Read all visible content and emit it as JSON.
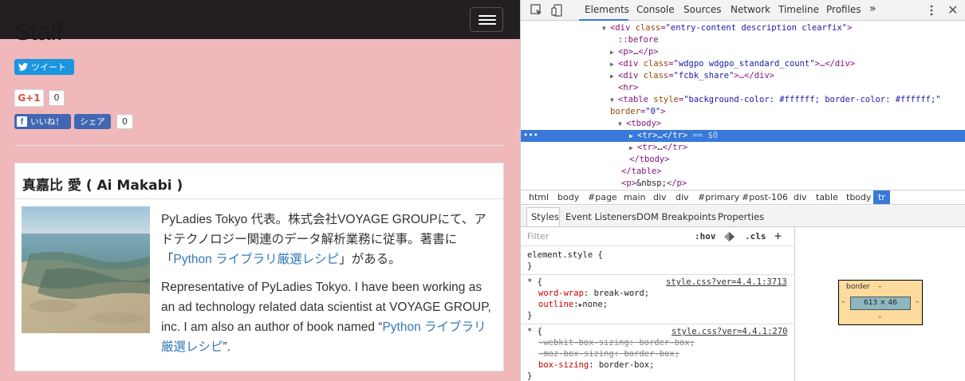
{
  "page": {
    "title": "Staff",
    "tweet_label": "ツイート",
    "gplus_label": "G+1",
    "gplus_count": "0",
    "fb_like_label": "いいね！",
    "fb_share_label": "シェア",
    "fb_count": "0",
    "person_name": "真嘉比 愛 ( Ai Makabi )",
    "bio_ja_pre": "PyLadies Tokyo 代表。株式会社VOYAGE GROUPにて、アドテクノロジー関連のデータ解析業務に従事。著書に「",
    "bio_ja_link": "Python ライブラリ厳選レシピ",
    "bio_ja_post": "」がある。",
    "bio_en_pre": "Representative of PyLadies Tokyo. I have been working as an ad technology related data scientist at VOYAGE GROUP, inc. I am also an author of book named “",
    "bio_en_link": "Python ライブラリ厳選レシピ",
    "bio_en_post": "”."
  },
  "devtools": {
    "tabs": [
      "Elements",
      "Console",
      "Sources",
      "Network",
      "Timeline",
      "Profiles"
    ],
    "more_tabs": "»",
    "dom": [
      {
        "tag_open": "<div ",
        "attr": "class",
        "val": "\"entry-content description clearfix\"",
        "close": ">"
      },
      {
        "text": "::before"
      },
      {
        "tag_open": "<p>",
        "text": "…",
        "close": "</p>"
      },
      {
        "tag_open": "<div ",
        "attr": "class",
        "val": "\"wdgpo wdgpo_standard_count\"",
        "close": ">…</div>"
      },
      {
        "tag_open": "<div ",
        "attr": "class",
        "val": "\"fcbk_share\"",
        "close": ">…</div>"
      },
      {
        "tag_open": "<hr>"
      },
      {
        "tag_open": "<table ",
        "attr": "style",
        "val": "\"background-color: #ffffff; border-color: #ffffff;\"",
        "close": ""
      },
      {
        "attr": "border",
        "val": "\"0\"",
        "close": ">"
      },
      {
        "tag_open": "<tbody>"
      },
      {
        "tag_open": "<tr>",
        "text": "…",
        "close": "</tr>",
        "marker": " == $0"
      },
      {
        "tag_open": "<tr>",
        "text": "…",
        "close": "</tr>"
      },
      {
        "tag_open": "</tbody>"
      },
      {
        "tag_open": "</table>"
      },
      {
        "tag_open": "<p>",
        "text": "&nbsp;",
        "close": "</p>"
      }
    ],
    "breadcrumbs": [
      "html",
      "body",
      "#page",
      "main",
      "div",
      "div",
      "#primary",
      "#post-106",
      "div",
      "table",
      "tbody",
      "tr"
    ],
    "sub_tabs": [
      "Styles",
      "Event Listeners",
      "DOM Breakpoints",
      "Properties"
    ],
    "filter_placeholder": "Filter",
    "hov_label": ":hov",
    "cls_label": ".cls",
    "plus_label": "+",
    "styles": {
      "element_style": "element.style {",
      "close_brace": "}",
      "rule1_selector": "* {",
      "rule1_source": "style.css?ver=4.4.1:3713",
      "rule1_prop1": "word-wrap",
      "rule1_val1": "break-word;",
      "rule1_prop2": "outline",
      "rule1_val2": "none;",
      "rule2_selector": "* {",
      "rule2_source": "style.css?ver=4.4.1:270",
      "rule2_prop1": "-webkit-box-sizing",
      "rule2_val1": "border-box;",
      "rule2_prop2": "-moz-box-sizing",
      "rule2_val2": "border-box;",
      "rule2_prop3": "box-sizing",
      "rule2_val3": "border-box;"
    },
    "box_model": {
      "border_label": "border",
      "dash": "–",
      "content_size": "613 × 46"
    }
  }
}
